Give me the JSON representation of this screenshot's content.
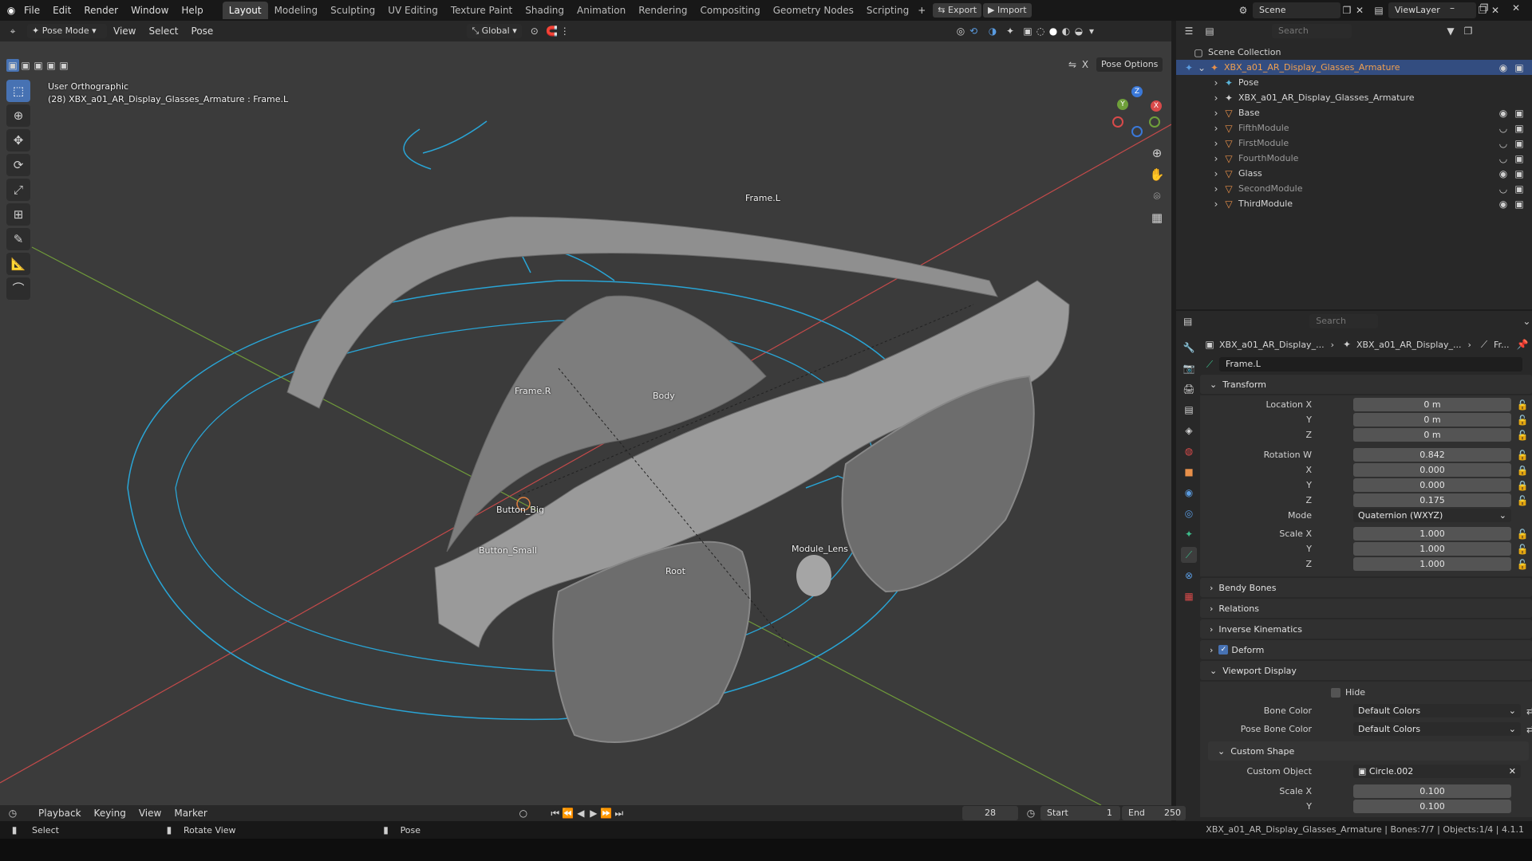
{
  "menu": {
    "items": [
      "File",
      "Edit",
      "Render",
      "Window",
      "Help"
    ]
  },
  "workspaces": [
    "Layout",
    "Modeling",
    "Sculpting",
    "UV Editing",
    "Texture Paint",
    "Shading",
    "Animation",
    "Rendering",
    "Compositing",
    "Geometry Nodes",
    "Scripting"
  ],
  "active_workspace": "Layout",
  "export_label": "Export",
  "import_label": "Import",
  "scene": "Scene",
  "view_layer": "ViewLayer",
  "viewport_header": {
    "mode": "Pose Mode",
    "menus": [
      "View",
      "Select",
      "Pose"
    ],
    "transform_orientation": "Global",
    "pose_options": "Pose Options"
  },
  "viewport_info": {
    "view_name": "User Orthographic",
    "object_line": "(28) XBX_a01_AR_Display_Glasses_Armature : Frame.L"
  },
  "bone_labels": {
    "frame_l": "Frame.L",
    "frame_r": "Frame.R",
    "body": "Body",
    "button_big": "Button_Big",
    "button_small": "Button_Small",
    "module_lens": "Module_Lens",
    "root": "Root"
  },
  "gizmo": {
    "x": "X",
    "y": "Y",
    "z": "Z"
  },
  "outliner": {
    "search_placeholder": "Search",
    "root": "Scene Collection",
    "armature": "XBX_a01_AR_Display_Glasses_Armature",
    "items": [
      {
        "name": "Pose",
        "dim": false
      },
      {
        "name": "XBX_a01_AR_Display_Glasses_Armature",
        "dim": false
      },
      {
        "name": "Base",
        "dim": false
      },
      {
        "name": "FifthModule",
        "dim": true
      },
      {
        "name": "FirstModule",
        "dim": true
      },
      {
        "name": "FourthModule",
        "dim": true
      },
      {
        "name": "Glass",
        "dim": false
      },
      {
        "name": "SecondModule",
        "dim": true
      },
      {
        "name": "ThirdModule",
        "dim": false
      }
    ]
  },
  "properties": {
    "search_placeholder": "Search",
    "breadcrumb": [
      "XBX_a01_AR_Display_...",
      "XBX_a01_AR_Display_...",
      "Fr..."
    ],
    "bone_name": "Frame.L",
    "transform": {
      "title": "Transform",
      "location_x_label": "Location X",
      "location_x": "0 m",
      "location_y_label": "Y",
      "location_y": "0 m",
      "location_z_label": "Z",
      "location_z": "0 m",
      "rotation_w_label": "Rotation W",
      "rotation_w": "0.842",
      "rotation_x_label": "X",
      "rotation_x": "0.000",
      "rotation_y_label": "Y",
      "rotation_y": "0.000",
      "rotation_z_label": "Z",
      "rotation_z": "0.175",
      "mode_label": "Mode",
      "mode": "Quaternion (WXYZ)",
      "scale_x_label": "Scale X",
      "scale_x": "1.000",
      "scale_y_label": "Y",
      "scale_y": "1.000",
      "scale_z_label": "Z",
      "scale_z": "1.000"
    },
    "panels": [
      "Bendy Bones",
      "Relations",
      "Inverse Kinematics",
      "Deform",
      "Viewport Display"
    ],
    "viewport_display": {
      "hide_label": "Hide",
      "bone_color_label": "Bone Color",
      "bone_color": "Default Colors",
      "pose_bone_color_label": "Pose Bone Color",
      "pose_bone_color": "Default Colors",
      "custom_shape_title": "Custom Shape",
      "custom_object_label": "Custom Object",
      "custom_object": "Circle.002",
      "scale_x_label": "Scale X",
      "scale_x": "0.100",
      "scale_y_label": "Y",
      "scale_y": "0.100"
    }
  },
  "timeline": {
    "menus": [
      "Playback",
      "Keying",
      "View",
      "Marker"
    ],
    "current_frame": "28",
    "start_label": "Start",
    "start": "1",
    "end_label": "End",
    "end": "250"
  },
  "status": {
    "select": "Select",
    "rotate_view": "Rotate View",
    "pose": "Pose",
    "info": "XBX_a01_AR_Display_Glasses_Armature | Bones:7/7 | Objects:1/4 | 4.1.1"
  },
  "colors": {
    "accent": "#4772b3",
    "selection": "#334d80",
    "x_axis": "#d84a4a",
    "y_axis": "#6fa03a",
    "bone_outline": "#29a5d6",
    "viewport_bg": "#3b3b3b"
  }
}
